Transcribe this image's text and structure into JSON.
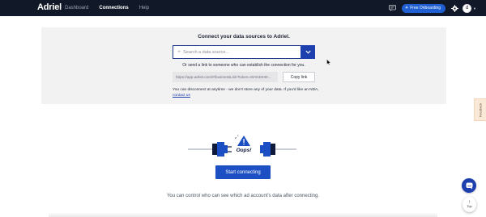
{
  "nav": {
    "logo": "Adriel",
    "links": [
      {
        "label": "Dashboard",
        "active": false
      },
      {
        "label": "Connections",
        "active": true
      },
      {
        "label": "Help",
        "active": false
      }
    ],
    "onboarding_button": "Free Onboarding",
    "avatar_initial": "d"
  },
  "panel": {
    "title": "Connect your data sources to Adriel.",
    "search_placeholder": "Search a data source...",
    "link_hint": "Or send a link to someone who can establish the connection for you.",
    "share_link": "https://app.adriel.com/#/businessLink?token=WAND330...",
    "copy_button": "Copy link",
    "disclaimer": "You can disconnect at anytime - we don't store any of your data. If you'd like an NDA,",
    "contact_link": "contact us"
  },
  "feedback_label": "Feedback",
  "illustration": {
    "oops_text": "Oops!"
  },
  "start_button": "Start connecting",
  "control_note": "You can control who can see which ad account's data after connecting.",
  "top_button_label": "Top",
  "colors": {
    "navbar": "#111827",
    "accent": "#1e40af",
    "panel_bg": "#f2f2f3",
    "feedback_bg": "#fbe9d7"
  }
}
